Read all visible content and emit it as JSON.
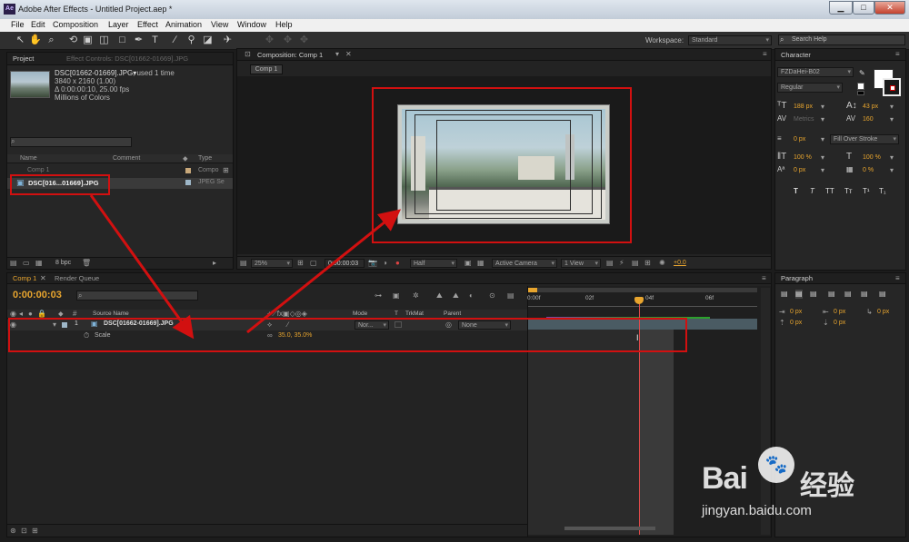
{
  "window": {
    "title": "Adobe After Effects - Untitled Project.aep *",
    "logo": "Ae"
  },
  "menu": [
    "File",
    "Edit",
    "Composition",
    "Layer",
    "Effect",
    "Animation",
    "View",
    "Window",
    "Help"
  ],
  "toolbar": {
    "workspace_label": "Workspace:",
    "workspace_value": "Standard",
    "search_placeholder": "Search Help"
  },
  "project": {
    "tabs": [
      "Project",
      "Effect Controls: DSC[01662-01669].JPG"
    ],
    "item_name": "DSC[01662-01669].JPG▾",
    "used": ", used 1 time",
    "dims": "3840 x 2160 (1.00)",
    "duration": "Δ 0:00:00:10, 25.00 fps",
    "colors": "Millions of Colors",
    "columns": [
      "Name",
      "Comment",
      "Type"
    ],
    "rows": [
      {
        "name": "Comp 1",
        "type": "Compo"
      },
      {
        "name": "DSC[016...01669].JPG",
        "type": "JPEG Se"
      }
    ],
    "bpc": "8 bpc"
  },
  "composition": {
    "tab": "Composition: Comp 1",
    "subtab": "Comp 1",
    "zoom": "25%",
    "timecode": "0:00:00:03",
    "resolution": "Half",
    "camera": "Active Camera",
    "views": "1 View",
    "exposure": "+0.0"
  },
  "character": {
    "tab": "Character",
    "font": "FZDaHei-B02",
    "style": "Regular",
    "size": "188 px",
    "leading": "43 px",
    "kerning": "Metrics",
    "tracking": "160",
    "stroke_width": "0 px",
    "stroke_mode": "Fill Over Stroke",
    "vscale": "100 %",
    "hscale": "100 %",
    "baseline": "0 px",
    "tsume": "0 %",
    "styles": [
      "T",
      "T",
      "TT",
      "Tт",
      "T¹",
      "T₁"
    ]
  },
  "paragraph": {
    "tab": "Paragraph",
    "values": [
      "0 px",
      "0 px",
      "0 px",
      "0 px",
      "0 px"
    ]
  },
  "timeline": {
    "tabs": [
      "Comp 1",
      "Render Queue"
    ],
    "timecode": "0:00:00:03",
    "columns": [
      "Source Name",
      "Mode",
      "T",
      "TrkMat",
      "Parent"
    ],
    "layer_num": "1",
    "layer_name": "DSC[01662-01669].JPG",
    "layer_mode": "Nor...",
    "layer_parent": "None",
    "property": "Scale",
    "scale_value": "35.0, 35.0%",
    "ruler": [
      "0:00f",
      "02f",
      "04f",
      "06f"
    ],
    "cursor": "I"
  },
  "watermark": {
    "brand": "Bai",
    "brand2": "经验",
    "url": "jingyan.baidu.com"
  },
  "colors": {
    "accent": "#e8a52e",
    "highlight": "#d21010"
  }
}
